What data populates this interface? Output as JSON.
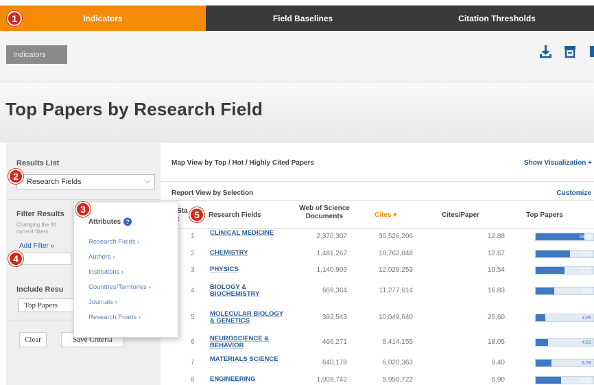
{
  "nav": {
    "tabs": [
      {
        "label": "Indicators",
        "active": true
      },
      {
        "label": "Field Baselines",
        "active": false
      },
      {
        "label": "Citation Thresholds",
        "active": false
      }
    ]
  },
  "callouts": [
    "1",
    "2",
    "3",
    "4",
    "5"
  ],
  "toolbar": {
    "button_label": "Indicators",
    "icons": [
      "download-icon",
      "print-icon",
      "share-icon"
    ]
  },
  "page": {
    "title": "Top Papers by Research Field"
  },
  "sidebar": {
    "results_list_label": "Results List",
    "results_select": "Research Fields",
    "filter_results_label": "Filter Results",
    "filter_note": "Changing the filt current filters",
    "add_filter": "Add Filter »",
    "include_label": "Include Resu",
    "include_select": "Top Papers",
    "clear_button": "Clear",
    "save_button": "Save Criteria"
  },
  "attributes_popover": {
    "title": "Attributes",
    "info_glyph": "?",
    "items": [
      "Research Fields ›",
      "Authors ›",
      "Institutions ›",
      "Countries/Territories ›",
      "Journals ›",
      "Research Fronts ›"
    ]
  },
  "main": {
    "map_view_label": "Map View by Top / Hot / Highly Cited Papers",
    "show_visualization": "Show Visualization +",
    "report_view_label": "Report View by Selection",
    "customize": "Customize",
    "columns": {
      "rank": "Sta t",
      "field": "Research Fields",
      "docs": "Web of Science Documents",
      "cites": "Cites ▾",
      "cites_per_paper": "Cites/Paper",
      "top_papers": "Top Papers"
    },
    "rows": [
      {
        "rank": "1",
        "field": "CLINICAL MEDICINE",
        "docs": "2,370,307",
        "cites": "30,526,206",
        "cpp": "12.88",
        "top": "23,76",
        "fill": 0.84
      },
      {
        "rank": "2",
        "field": "CHEMISTRY",
        "docs": "1,481,267",
        "cites": "18,762,848",
        "cpp": "12.67",
        "top": "15,01",
        "fill": 0.6
      },
      {
        "rank": "3",
        "field": "PHYSICS",
        "docs": "1,140,909",
        "cites": "12,029,253",
        "cpp": "10.54",
        "top": "11,27",
        "fill": 0.5
      },
      {
        "rank": "4",
        "field": "BIOLOGY & BIOCHEMISTRY",
        "docs": "669,364",
        "cites": "11,277,614",
        "cpp": "16.83",
        "top": "6,74",
        "fill": 0.32
      },
      {
        "rank": "5",
        "field": "MOLECULAR BIOLOGY & GENETICS",
        "docs": "392,543",
        "cites": "10,049,640",
        "cpp": "25.60",
        "top": "3,95",
        "fill": 0.17
      },
      {
        "rank": "6",
        "field": "NEUROSCIENCE & BEHAVIOR",
        "docs": "466,271",
        "cites": "8,414,155",
        "cpp": "18.05",
        "top": "4,81",
        "fill": 0.22
      },
      {
        "rank": "7",
        "field": "MATERIALS SCIENCE",
        "docs": "640,179",
        "cites": "6,020,363",
        "cpp": "9.40",
        "top": "6,59",
        "fill": 0.27
      },
      {
        "rank": "8",
        "field": "ENGINEERING",
        "docs": "1,008,742",
        "cites": "5,950,722",
        "cpp": "5.90",
        "top": "10,02",
        "fill": 0.44
      }
    ]
  },
  "colors": {
    "accent": "#f58a07",
    "nav_bg": "#3a3a3a",
    "link": "#1d5f9e",
    "bar": "#3f79c4",
    "callout": "#d7261e"
  }
}
